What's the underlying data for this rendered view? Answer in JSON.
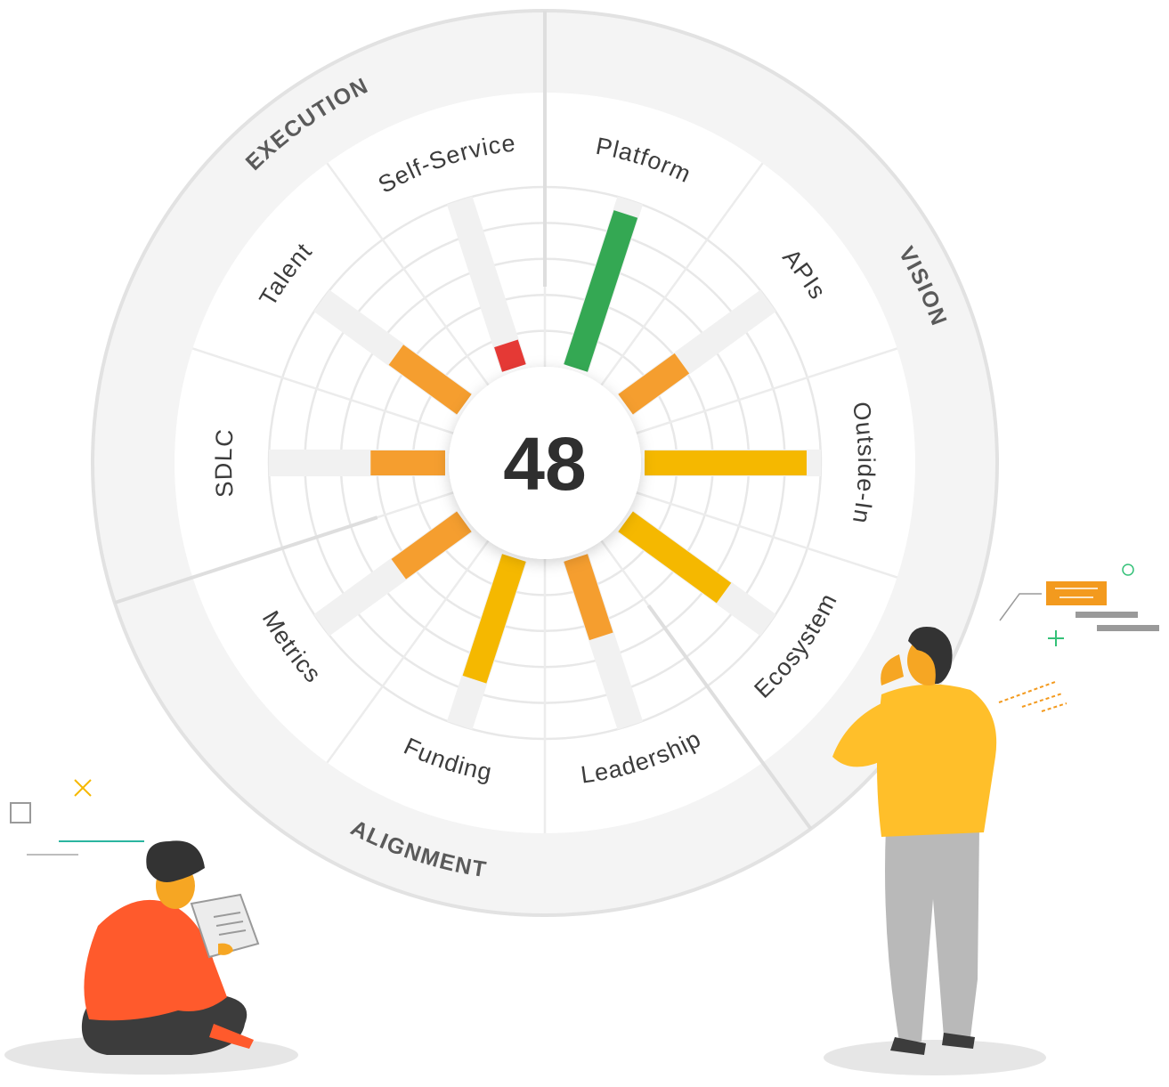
{
  "chart_data": {
    "type": "radial-bar",
    "score": "48",
    "categories": [
      "Platform",
      "APIs",
      "Outside-In",
      "Ecosystem",
      "Leadership",
      "Funding",
      "Metrics",
      "SDLC",
      "Talent",
      "Self-Service"
    ],
    "values": [
      100,
      43,
      100,
      75,
      51,
      79,
      50,
      46,
      52,
      16
    ],
    "max": 100,
    "grid": true,
    "groups": [
      {
        "label": "VISION",
        "categories": [
          "Platform",
          "APIs",
          "Outside-In",
          "Ecosystem"
        ]
      },
      {
        "label": "ALIGNMENT",
        "categories": [
          "Leadership",
          "Funding",
          "Metrics"
        ]
      },
      {
        "label": "EXECUTION",
        "categories": [
          "SDLC",
          "Talent",
          "Self-Service"
        ]
      }
    ],
    "colors": {
      "high": "#34a853",
      "mid": "#f5b800",
      "low": "#f59e2f",
      "critical": "#e53935",
      "track": "#f1f1f1",
      "ring": "#f4f4f4",
      "grid": "#e8e8e8"
    }
  }
}
